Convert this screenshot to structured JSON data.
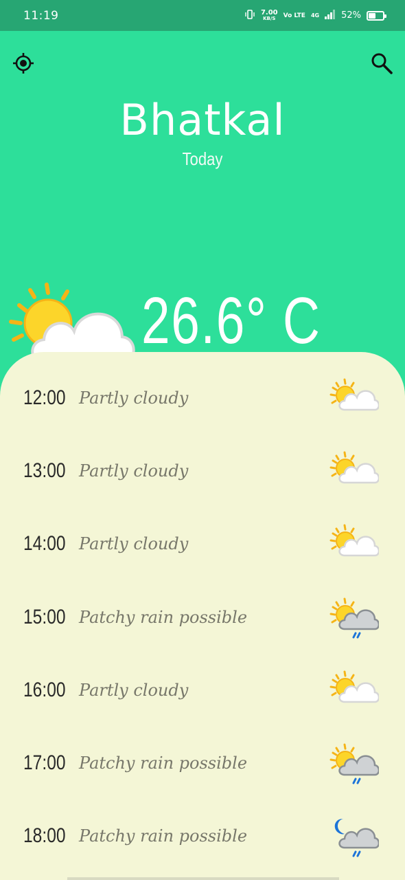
{
  "status_bar": {
    "time": "11:19",
    "speed_value": "7.00",
    "speed_unit": "KB/S",
    "volte": "Vo LTE",
    "network": "4G",
    "battery": "52%",
    "battery_level": 0.52
  },
  "header": {
    "locate_icon": "location-crosshair-icon",
    "search_icon": "search-icon",
    "city": "Bhatkal",
    "day": "Today"
  },
  "current": {
    "temperature": "26.6° C",
    "icon": "partly-cloudy-icon"
  },
  "hourly": [
    {
      "time": "12:00",
      "condition": "Partly cloudy",
      "icon": "partly-cloudy"
    },
    {
      "time": "13:00",
      "condition": "Partly cloudy",
      "icon": "partly-cloudy"
    },
    {
      "time": "14:00",
      "condition": "Partly cloudy",
      "icon": "partly-cloudy"
    },
    {
      "time": "15:00",
      "condition": "Patchy rain possible",
      "icon": "patchy-rain-day"
    },
    {
      "time": "16:00",
      "condition": "Partly cloudy",
      "icon": "partly-cloudy"
    },
    {
      "time": "17:00",
      "condition": "Patchy rain possible",
      "icon": "patchy-rain-day"
    },
    {
      "time": "18:00",
      "condition": "Patchy rain possible",
      "icon": "patchy-rain-night"
    }
  ],
  "colors": {
    "header_bg": "#2ddf9a",
    "statusbar_bg": "#27a673",
    "sheet_bg": "#f4f6d6",
    "condition_text": "#77776a"
  }
}
